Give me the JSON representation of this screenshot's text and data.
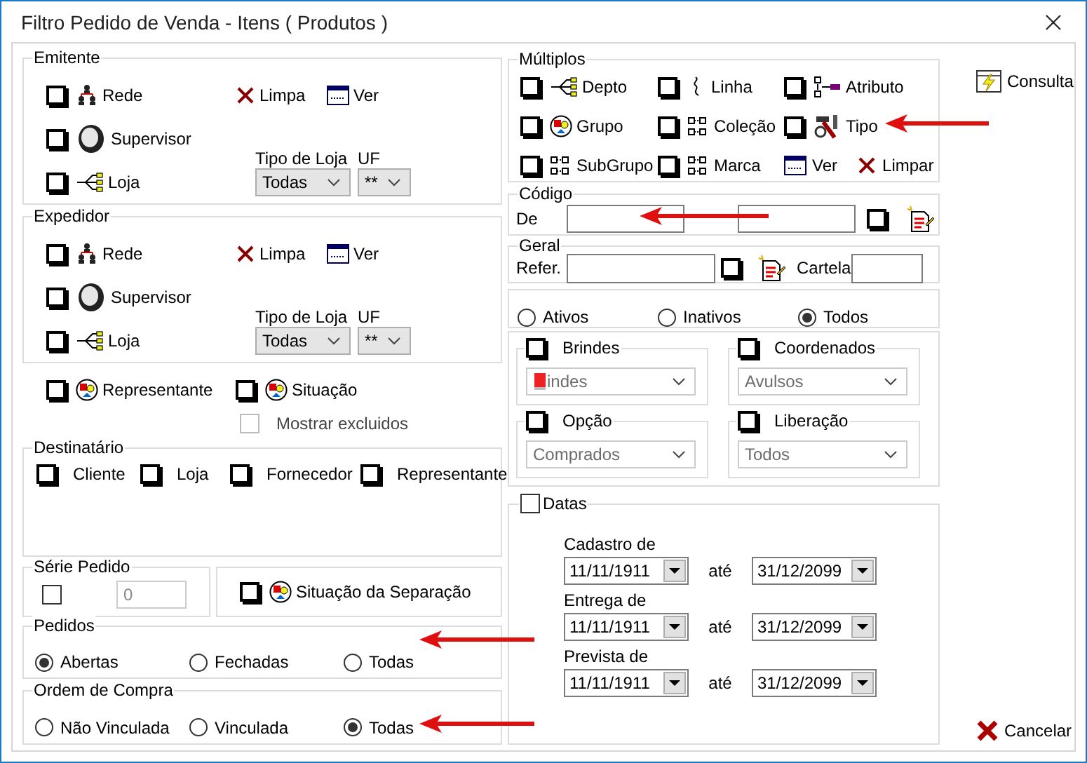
{
  "window": {
    "title": "Filtro Pedido de Venda - Itens ( Produtos )"
  },
  "emitente": {
    "title": "Emitente",
    "rede": {
      "label": "Rede",
      "checked": false
    },
    "supervisor": {
      "label": "Supervisor",
      "checked": false
    },
    "loja": {
      "label": "Loja",
      "checked": false
    },
    "limpa": "Limpa",
    "ver": "Ver",
    "tipo_loja": {
      "label": "Tipo de Loja",
      "value": "Todas",
      "disabled": false
    },
    "uf": {
      "label": "UF",
      "value": "**",
      "disabled": false
    }
  },
  "expedidor": {
    "title": "Expedidor",
    "rede": {
      "label": "Rede",
      "checked": false
    },
    "supervisor": {
      "label": "Supervisor",
      "checked": false
    },
    "loja": {
      "label": "Loja",
      "checked": false
    },
    "limpa": "Limpa",
    "ver": "Ver",
    "tipo_loja": {
      "label": "Tipo de Loja",
      "value": "Todas",
      "disabled": false
    },
    "uf": {
      "label": "UF",
      "value": "**",
      "disabled": false
    }
  },
  "representante": {
    "label": "Representante",
    "checked": false
  },
  "situacao": {
    "label": "Situação",
    "checked": false
  },
  "mostrar_excluidos": {
    "label": "Mostrar excluidos",
    "checked": false,
    "disabled": true
  },
  "destinatario": {
    "title": "Destinatário",
    "options": [
      {
        "label": "Cliente",
        "checked": false
      },
      {
        "label": "Loja",
        "checked": false
      },
      {
        "label": "Fornecedor",
        "checked": false
      },
      {
        "label": "Representante",
        "checked": false
      }
    ]
  },
  "serie_pedido": {
    "title": "Série Pedido",
    "checked": false,
    "value": "0",
    "disabled": true
  },
  "situacao_separacao": {
    "label": "Situação da Separação",
    "checked": false
  },
  "pedidos": {
    "title": "Pedidos",
    "options": [
      {
        "label": "Abertas",
        "selected": true
      },
      {
        "label": "Fechadas",
        "selected": false
      },
      {
        "label": "Todas",
        "selected": false
      }
    ]
  },
  "ordem_compra": {
    "title": "Ordem de Compra",
    "options": [
      {
        "label": "Não Vinculada",
        "selected": false
      },
      {
        "label": "Vinculada",
        "selected": false
      },
      {
        "label": "Todas",
        "selected": true
      }
    ]
  },
  "multiplos": {
    "title": "Múltiplos",
    "items": [
      {
        "label": "Depto",
        "checked": false
      },
      {
        "label": "Linha",
        "checked": false
      },
      {
        "label": "Atributo",
        "checked": false
      },
      {
        "label": "Grupo",
        "checked": false
      },
      {
        "label": "Coleção",
        "checked": false
      },
      {
        "label": "Tipo",
        "checked": false
      },
      {
        "label": "SubGrupo",
        "checked": false
      },
      {
        "label": "Marca",
        "checked": false
      }
    ],
    "ver": "Ver",
    "limpar": "Limpar"
  },
  "codigo": {
    "title": "Código",
    "from_label": "De",
    "checked": false
  },
  "geral": {
    "title": "Geral",
    "refer_label": "Refer.",
    "checked": false,
    "cartela_label": "Cartela"
  },
  "status": {
    "options": [
      {
        "label": "Ativos",
        "selected": false
      },
      {
        "label": "Inativos",
        "selected": false
      },
      {
        "label": "Todos",
        "selected": true
      }
    ]
  },
  "combos": [
    {
      "label": "Brindes",
      "checked": false,
      "value": "indes",
      "disabled": true
    },
    {
      "label": "Coordenados",
      "checked": false,
      "value": "Avulsos",
      "disabled": true
    },
    {
      "label": "Opção",
      "checked": false,
      "value": "Comprados",
      "disabled": true
    },
    {
      "label": "Liberação",
      "checked": false,
      "value": "Todos",
      "disabled": true
    }
  ],
  "datas": {
    "title": "Datas",
    "checked": false,
    "rows": [
      {
        "label": "Cadastro de",
        "from": "11/11/1911",
        "until_label": "até",
        "to": "31/12/2099"
      },
      {
        "label": "Entrega de",
        "from": "11/11/1911",
        "until_label": "até",
        "to": "31/12/2099"
      },
      {
        "label": "Prevista de",
        "from": "11/11/1911",
        "until_label": "até",
        "to": "31/12/2099"
      }
    ]
  },
  "consulta": "Consulta",
  "cancelar": "Cancelar"
}
